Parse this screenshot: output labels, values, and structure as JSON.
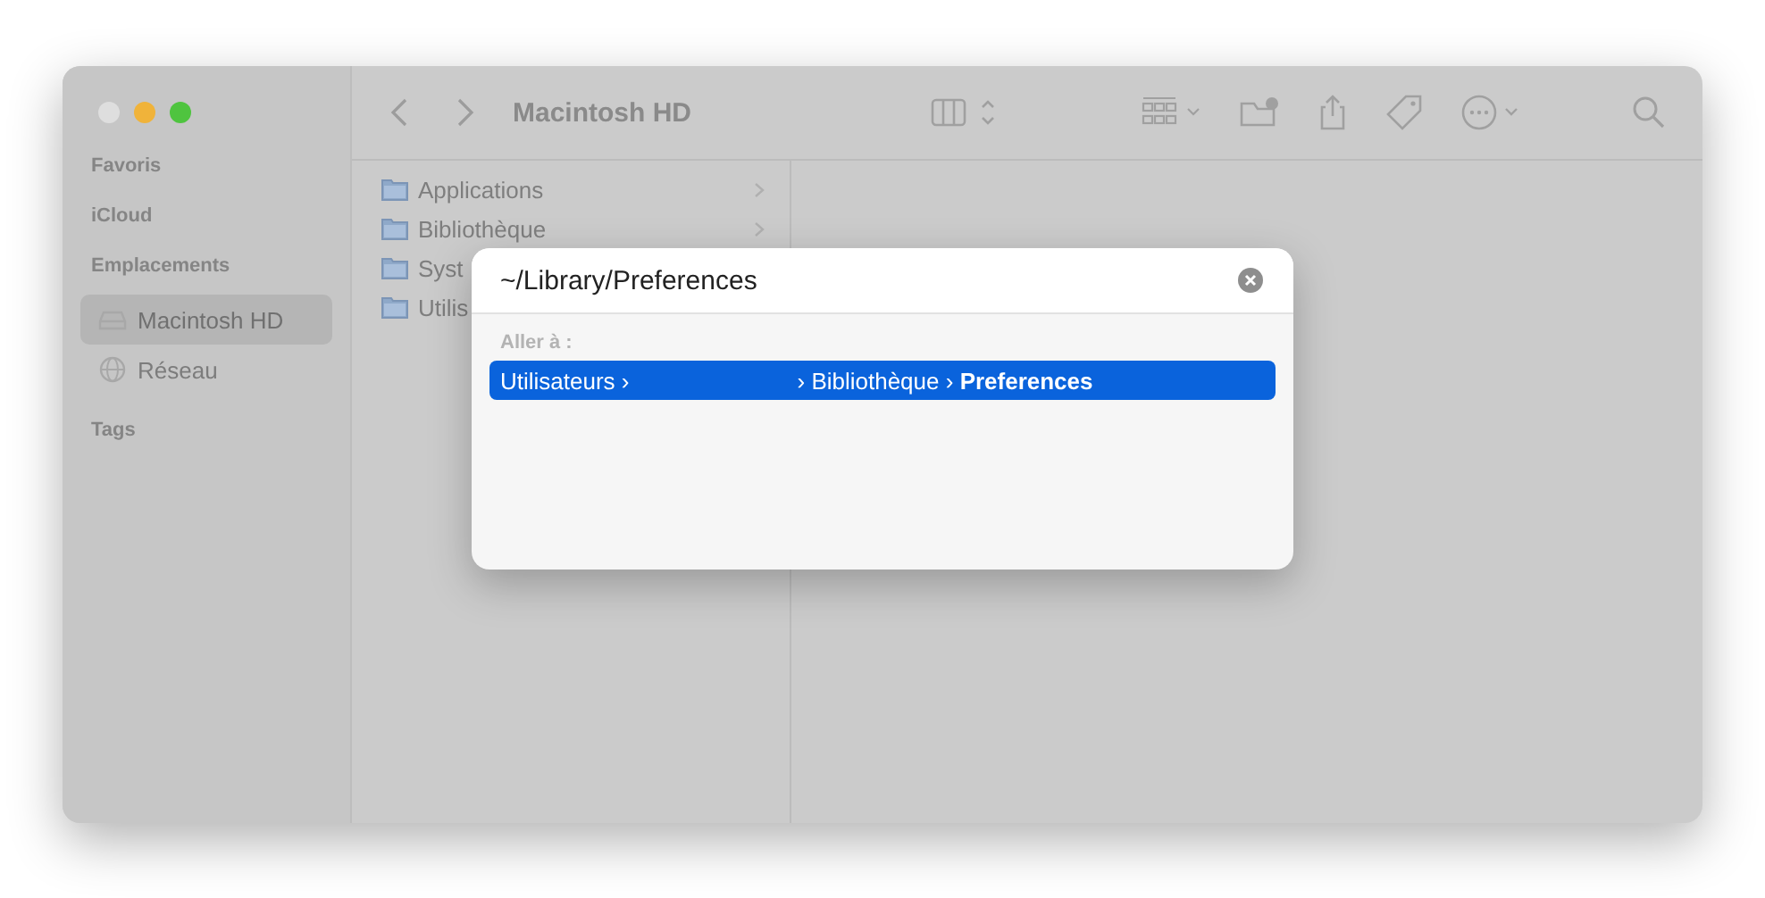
{
  "window": {
    "title": "Macintosh HD"
  },
  "sidebar": {
    "sections": [
      {
        "title": "Favoris"
      },
      {
        "title": "iCloud"
      },
      {
        "title": "Emplacements",
        "items": [
          {
            "label": "Macintosh HD",
            "kind": "disk",
            "selected": true
          },
          {
            "label": "Réseau",
            "kind": "network",
            "selected": false
          }
        ]
      },
      {
        "title": "Tags"
      }
    ]
  },
  "column": {
    "items": [
      {
        "label": "Applications",
        "expandable": true
      },
      {
        "label": "Bibliothèque",
        "expandable": true
      },
      {
        "label": "Syst"
      },
      {
        "label": "Utilis"
      }
    ]
  },
  "go_to_dialog": {
    "value": "~/Library/Preferences",
    "section_label": "Aller à :",
    "results": [
      {
        "segments": [
          "Utilisateurs ›",
          "› Bibliothèque › **Preferences**"
        ],
        "selected": true
      }
    ]
  }
}
